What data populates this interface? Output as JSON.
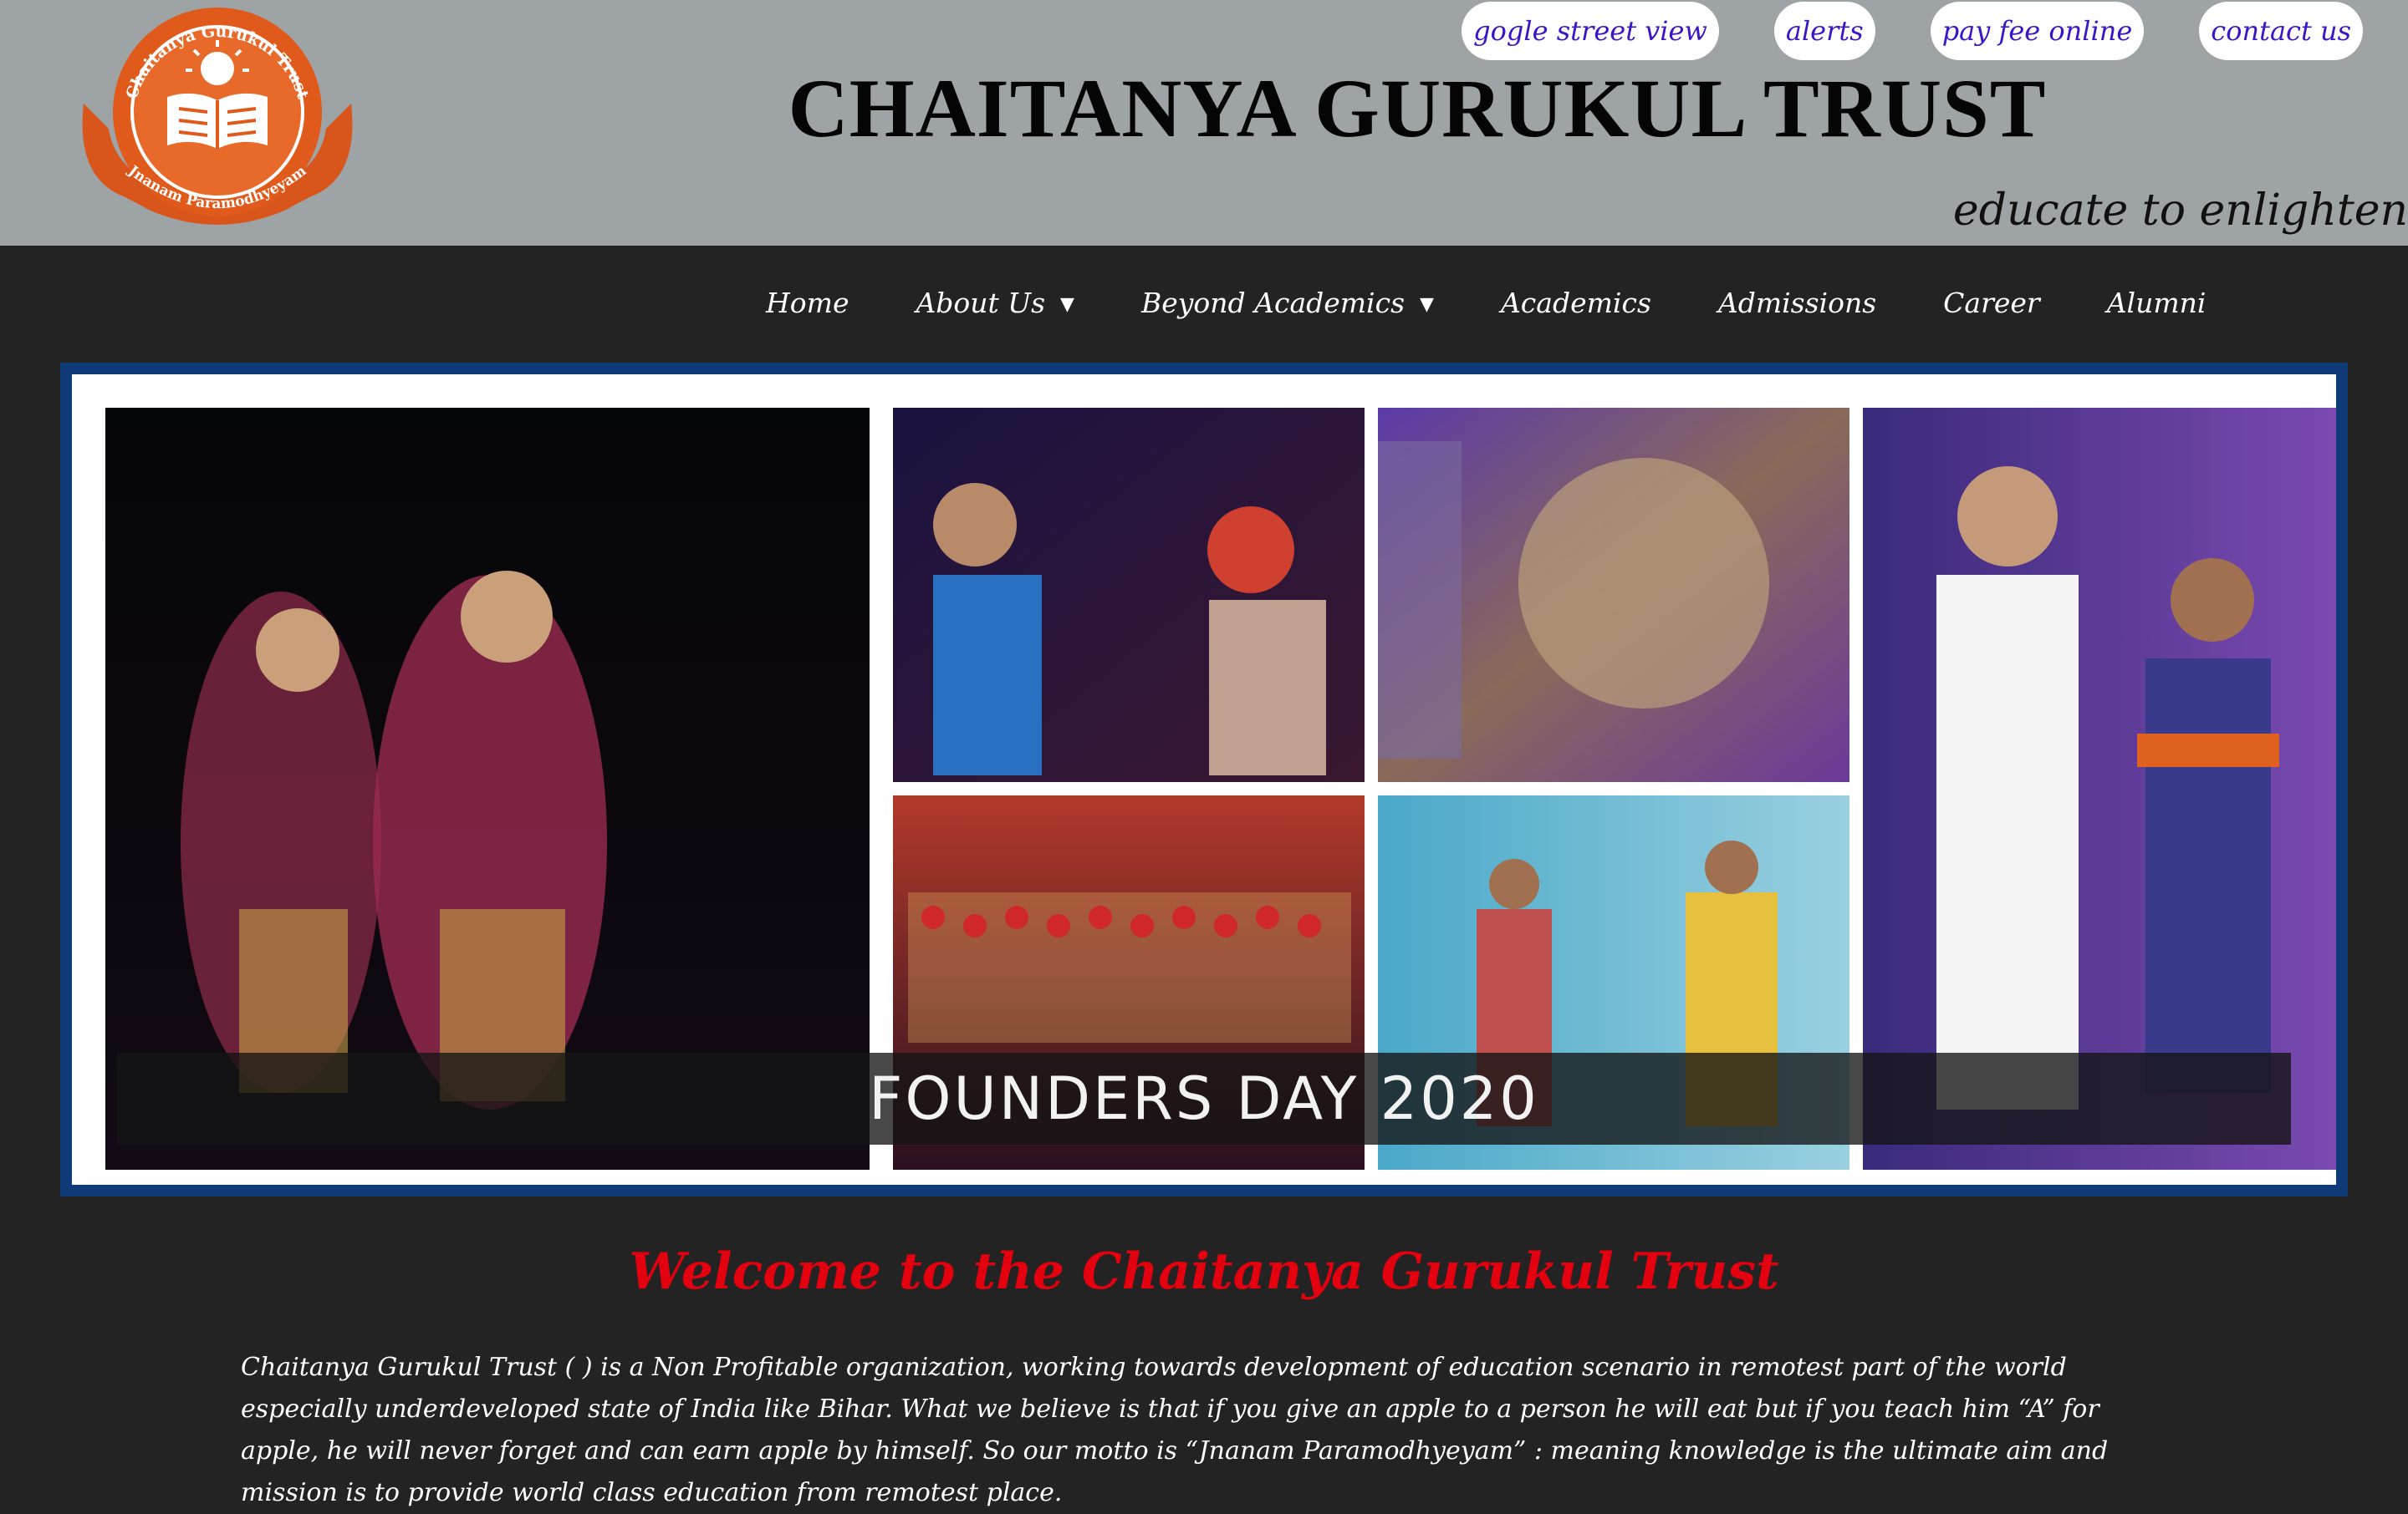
{
  "header": {
    "logo_alt": "Chaitanya Gurukul Trust",
    "logo_text_top": "Chaitanya Gurukul Trust",
    "logo_text_bottom": "Jnanam Paramodhyeyam",
    "title": "CHAITANYA GURUKUL TRUST",
    "tagline": "educate to enlighten",
    "top_links": [
      {
        "label": "gogle street view"
      },
      {
        "label": "alerts"
      },
      {
        "label": "pay fee online"
      },
      {
        "label": "contact us"
      }
    ]
  },
  "nav": {
    "items": [
      {
        "label": "Home",
        "has_dropdown": false
      },
      {
        "label": "About Us",
        "has_dropdown": true
      },
      {
        "label": "Beyond Academics",
        "has_dropdown": true
      },
      {
        "label": "Academics",
        "has_dropdown": false
      },
      {
        "label": "Admissions",
        "has_dropdown": false
      },
      {
        "label": "Career",
        "has_dropdown": false
      },
      {
        "label": "Alumni",
        "has_dropdown": false
      }
    ],
    "caret": "▼"
  },
  "banner": {
    "caption": "FOUNDERS DAY 2020"
  },
  "main": {
    "welcome_heading": "Welcome to the Chaitanya Gurukul Trust",
    "intro_text": "Chaitanya Gurukul Trust ( ) is a Non Profitable organization, working towards development of education scenario in remotest part of the world especially underdeveloped state of India like Bihar. What we believe is that if you give an apple to a person he will eat but if you teach him “A” for apple, he will never forget and can earn apple by himself. So our motto is “Jnanam Paramodhyeyam” : meaning knowledge is the ultimate aim and mission is to provide world class education from remotest place."
  },
  "colors": {
    "header_bg": "#9ea3a6",
    "nav_bg": "#232323",
    "welcome_red": "#e3000f",
    "link_purple": "#3b15c8",
    "logo_orange": "#e05a1c",
    "banner_border": "#0e3a78"
  }
}
